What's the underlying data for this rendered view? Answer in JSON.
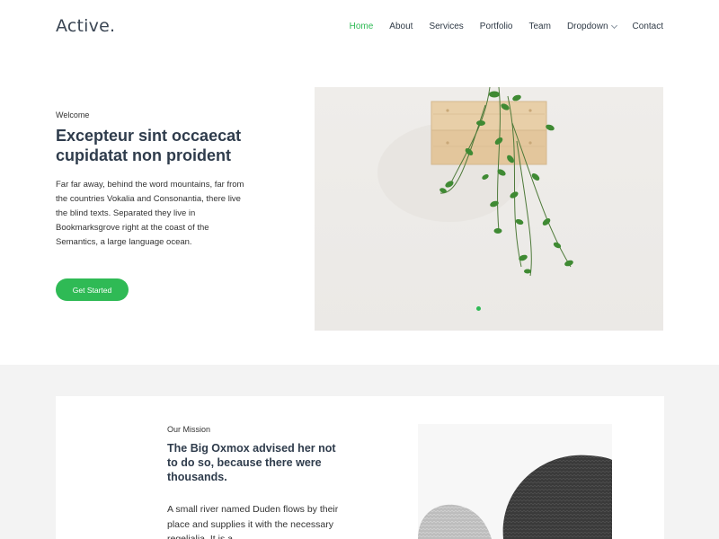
{
  "header": {
    "logo": "Active.",
    "nav": [
      {
        "label": "Home",
        "active": true
      },
      {
        "label": "About",
        "active": false
      },
      {
        "label": "Services",
        "active": false
      },
      {
        "label": "Portfolio",
        "active": false
      },
      {
        "label": "Team",
        "active": false
      },
      {
        "label": "Dropdown",
        "active": false
      },
      {
        "label": "Contact",
        "active": false
      }
    ]
  },
  "hero": {
    "eyebrow": "Welcome",
    "title": "Excepteur sint occaecat cupidatat non proident",
    "text": "Far far away, behind the word mountains, far from the countries Vokalia and Consonantia, there live the blind texts. Separated they live in Bookmarksgrove right at the coast of the Semantics, a large language ocean.",
    "button": "Get Started",
    "image": "hanging-plant-in-wooden-crate-image"
  },
  "mission": {
    "eyebrow": "Our Mission",
    "title": "The Big Oxmox advised her not to do so, because there were thousands.",
    "text": "A small river named Duden flows by their place and supplies it with the necessary regelialia. It is a",
    "image": "knit-poufs-image"
  },
  "colors": {
    "accent": "#2fba55",
    "heading": "#2f3c4c",
    "section_bg": "#f3f3f3"
  }
}
